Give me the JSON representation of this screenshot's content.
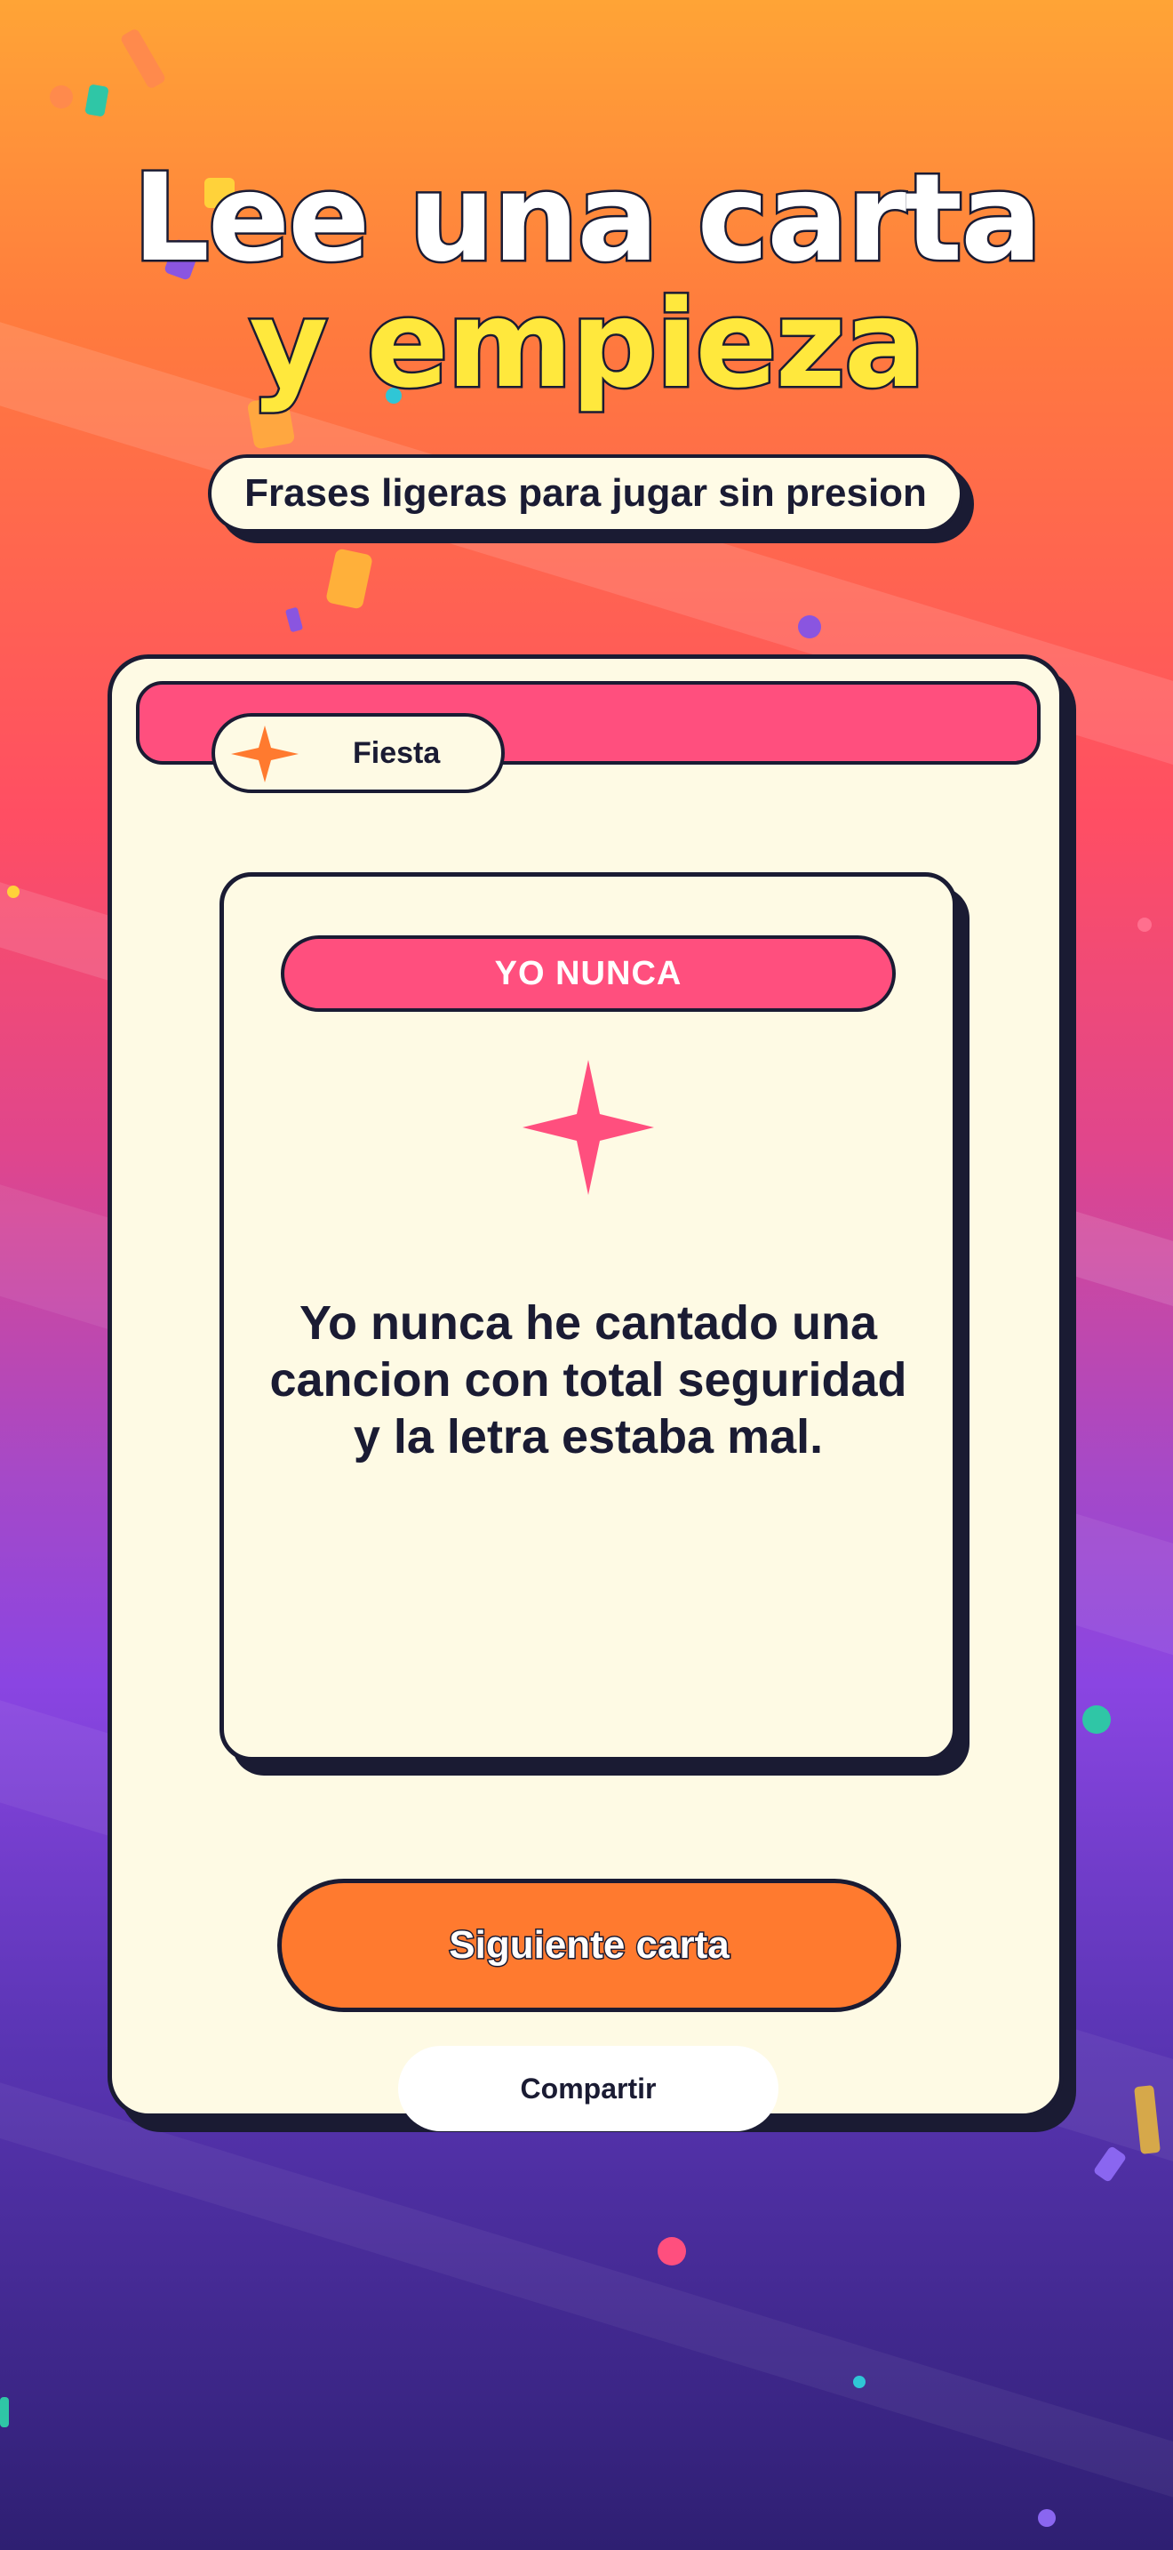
{
  "headline": {
    "line1": "Lee una carta",
    "line2": "y empieza"
  },
  "subtitle": "Frases ligeras para jugar sin presion",
  "card": {
    "category": {
      "label": "Fiesta",
      "icon": "four-point-star-icon",
      "icon_color": "#ff7a2f"
    },
    "type_label": "YO NUNCA",
    "decor_icon": "four-point-star-icon",
    "decor_icon_color": "#ff4f7e",
    "prompt": "Yo nunca he cantado una cancion con total seguridad y la letra estaba mal."
  },
  "actions": {
    "next_label": "Siguiente carta",
    "share_label": "Compartir"
  },
  "colors": {
    "accent_pink": "#ff4f7e",
    "accent_orange": "#ff7a2f",
    "headline_yellow": "#ffe83d",
    "ink": "#1a1b33",
    "card_cream": "#fefae4"
  }
}
